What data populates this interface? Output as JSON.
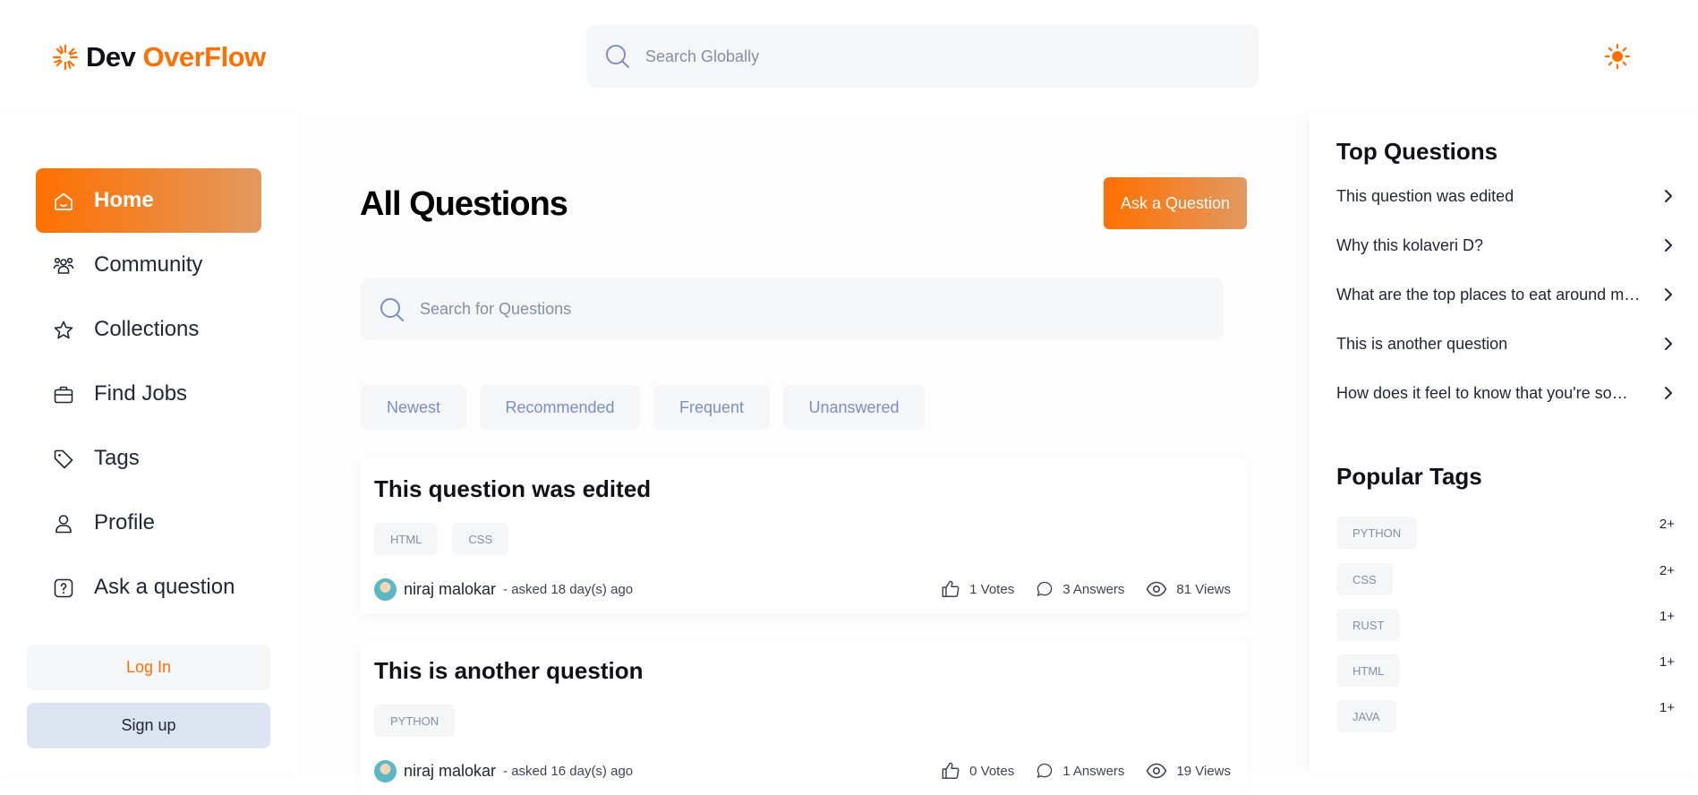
{
  "header": {
    "logo_prefix": "Dev",
    "logo_accent": "OverFlow",
    "global_search_placeholder": "Search Globally"
  },
  "sidebar": {
    "items": [
      {
        "label": "Home",
        "icon": "home-icon",
        "active": true
      },
      {
        "label": "Community",
        "icon": "users-icon",
        "active": false
      },
      {
        "label": "Collections",
        "icon": "star-icon",
        "active": false
      },
      {
        "label": "Find Jobs",
        "icon": "briefcase-icon",
        "active": false
      },
      {
        "label": "Tags",
        "icon": "tag-icon",
        "active": false
      },
      {
        "label": "Profile",
        "icon": "user-icon",
        "active": false
      },
      {
        "label": "Ask a question",
        "icon": "question-icon",
        "active": false
      }
    ],
    "login_label": "Log In",
    "signup_label": "Sign up"
  },
  "main": {
    "title": "All Questions",
    "ask_button_label": "Ask a Question",
    "search_placeholder": "Search for Questions",
    "filters": [
      "Newest",
      "Recommended",
      "Frequent",
      "Unanswered"
    ],
    "questions": [
      {
        "title": "This question was edited",
        "tags": [
          "HTML",
          "CSS"
        ],
        "author": "niraj malokar",
        "asked": "- asked 18 day(s) ago",
        "votes": "1 Votes",
        "answers": "3 Answers",
        "views": "81 Views"
      },
      {
        "title": "This is another question",
        "tags": [
          "PYTHON"
        ],
        "author": "niraj malokar",
        "asked": "- asked 16 day(s) ago",
        "votes": "0 Votes",
        "answers": "1 Answers",
        "views": "19 Views"
      }
    ]
  },
  "right_sidebar": {
    "top_questions_title": "Top Questions",
    "top_questions": [
      "This question was edited",
      "Why this kolaveri D?",
      "What are the top places to eat around me?",
      "This is another question",
      "How does it feel to know that you're so…"
    ],
    "popular_tags_title": "Popular Tags",
    "popular_tags": [
      {
        "name": "PYTHON",
        "count": "2+"
      },
      {
        "name": "CSS",
        "count": "2+"
      },
      {
        "name": "RUST",
        "count": "1+"
      },
      {
        "name": "HTML",
        "count": "1+"
      },
      {
        "name": "JAVA",
        "count": "1+"
      }
    ]
  },
  "colors": {
    "accent": "#ff7000",
    "accent_gradient_end": "#e2995f",
    "light_bg": "#f4f6f8",
    "muted_text": "#7b8ec8"
  }
}
